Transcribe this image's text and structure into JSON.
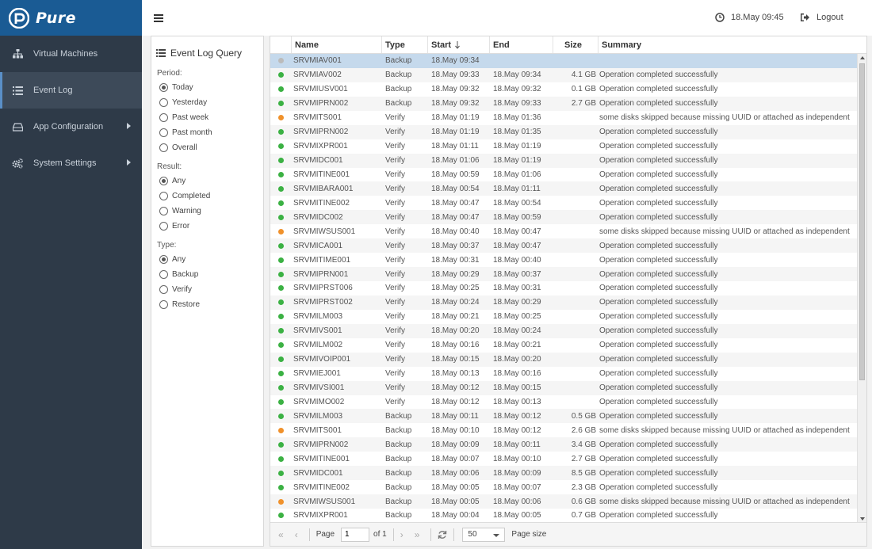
{
  "brand": {
    "name": "Pure",
    "color": "#1a5b94"
  },
  "sidebar": {
    "items": [
      {
        "label": "Virtual Machines",
        "icon": "sitemap-icon",
        "active": false,
        "has_arrow": false
      },
      {
        "label": "Event Log",
        "icon": "list-icon",
        "active": true,
        "has_arrow": false
      },
      {
        "label": "App Configuration",
        "icon": "drive-icon",
        "active": false,
        "has_arrow": true
      },
      {
        "label": "System Settings",
        "icon": "gears-icon",
        "active": false,
        "has_arrow": true
      }
    ]
  },
  "topbar": {
    "datetime": "18.May 09:45",
    "logout_label": "Logout"
  },
  "query": {
    "title": "Event Log Query",
    "period": {
      "label": "Period:",
      "options": [
        "Today",
        "Yesterday",
        "Past week",
        "Past month",
        "Overall"
      ],
      "selected": "Today"
    },
    "result": {
      "label": "Result:",
      "options": [
        "Any",
        "Completed",
        "Warning",
        "Error"
      ],
      "selected": "Any"
    },
    "type": {
      "label": "Type:",
      "options": [
        "Any",
        "Backup",
        "Verify",
        "Restore"
      ],
      "selected": "Any"
    }
  },
  "grid": {
    "columns": [
      "Name",
      "Type",
      "Start",
      "End",
      "Size",
      "Summary"
    ],
    "sort_column": "Start",
    "status_colors": {
      "success": "#3bb143",
      "warning": "#f0912b",
      "running": "#bbbbbb"
    },
    "rows": [
      {
        "status": "running",
        "name": "SRVMIAV001",
        "type": "Backup",
        "start": "18.May 09:34",
        "end": "",
        "size": "",
        "summary": "",
        "selected": true
      },
      {
        "status": "success",
        "name": "SRVMIAV002",
        "type": "Backup",
        "start": "18.May 09:33",
        "end": "18.May 09:34",
        "size": "4.1 GB",
        "summary": "Operation completed successfully"
      },
      {
        "status": "success",
        "name": "SRVMIUSV001",
        "type": "Backup",
        "start": "18.May 09:32",
        "end": "18.May 09:32",
        "size": "0.1 GB",
        "summary": "Operation completed successfully"
      },
      {
        "status": "success",
        "name": "SRVMIPRN002",
        "type": "Backup",
        "start": "18.May 09:32",
        "end": "18.May 09:33",
        "size": "2.7 GB",
        "summary": "Operation completed successfully"
      },
      {
        "status": "warning",
        "name": "SRVMITS001",
        "type": "Verify",
        "start": "18.May 01:19",
        "end": "18.May 01:36",
        "size": "",
        "summary": "some disks skipped because missing UUID or attached as independent"
      },
      {
        "status": "success",
        "name": "SRVMIPRN002",
        "type": "Verify",
        "start": "18.May 01:19",
        "end": "18.May 01:35",
        "size": "",
        "summary": "Operation completed successfully"
      },
      {
        "status": "success",
        "name": "SRVMIXPR001",
        "type": "Verify",
        "start": "18.May 01:11",
        "end": "18.May 01:19",
        "size": "",
        "summary": "Operation completed successfully"
      },
      {
        "status": "success",
        "name": "SRVMIDC001",
        "type": "Verify",
        "start": "18.May 01:06",
        "end": "18.May 01:19",
        "size": "",
        "summary": "Operation completed successfully"
      },
      {
        "status": "success",
        "name": "SRVMITINE001",
        "type": "Verify",
        "start": "18.May 00:59",
        "end": "18.May 01:06",
        "size": "",
        "summary": "Operation completed successfully"
      },
      {
        "status": "success",
        "name": "SRVMIBARA001",
        "type": "Verify",
        "start": "18.May 00:54",
        "end": "18.May 01:11",
        "size": "",
        "summary": "Operation completed successfully"
      },
      {
        "status": "success",
        "name": "SRVMITINE002",
        "type": "Verify",
        "start": "18.May 00:47",
        "end": "18.May 00:54",
        "size": "",
        "summary": "Operation completed successfully"
      },
      {
        "status": "success",
        "name": "SRVMIDC002",
        "type": "Verify",
        "start": "18.May 00:47",
        "end": "18.May 00:59",
        "size": "",
        "summary": "Operation completed successfully"
      },
      {
        "status": "warning",
        "name": "SRVMIWSUS001",
        "type": "Verify",
        "start": "18.May 00:40",
        "end": "18.May 00:47",
        "size": "",
        "summary": "some disks skipped because missing UUID or attached as independent"
      },
      {
        "status": "success",
        "name": "SRVMICA001",
        "type": "Verify",
        "start": "18.May 00:37",
        "end": "18.May 00:47",
        "size": "",
        "summary": "Operation completed successfully"
      },
      {
        "status": "success",
        "name": "SRVMITIME001",
        "type": "Verify",
        "start": "18.May 00:31",
        "end": "18.May 00:40",
        "size": "",
        "summary": "Operation completed successfully"
      },
      {
        "status": "success",
        "name": "SRVMIPRN001",
        "type": "Verify",
        "start": "18.May 00:29",
        "end": "18.May 00:37",
        "size": "",
        "summary": "Operation completed successfully"
      },
      {
        "status": "success",
        "name": "SRVMIPRST006",
        "type": "Verify",
        "start": "18.May 00:25",
        "end": "18.May 00:31",
        "size": "",
        "summary": "Operation completed successfully"
      },
      {
        "status": "success",
        "name": "SRVMIPRST002",
        "type": "Verify",
        "start": "18.May 00:24",
        "end": "18.May 00:29",
        "size": "",
        "summary": "Operation completed successfully"
      },
      {
        "status": "success",
        "name": "SRVMILM003",
        "type": "Verify",
        "start": "18.May 00:21",
        "end": "18.May 00:25",
        "size": "",
        "summary": "Operation completed successfully"
      },
      {
        "status": "success",
        "name": "SRVMIVS001",
        "type": "Verify",
        "start": "18.May 00:20",
        "end": "18.May 00:24",
        "size": "",
        "summary": "Operation completed successfully"
      },
      {
        "status": "success",
        "name": "SRVMILM002",
        "type": "Verify",
        "start": "18.May 00:16",
        "end": "18.May 00:21",
        "size": "",
        "summary": "Operation completed successfully"
      },
      {
        "status": "success",
        "name": "SRVMIVOIP001",
        "type": "Verify",
        "start": "18.May 00:15",
        "end": "18.May 00:20",
        "size": "",
        "summary": "Operation completed successfully"
      },
      {
        "status": "success",
        "name": "SRVMIEJ001",
        "type": "Verify",
        "start": "18.May 00:13",
        "end": "18.May 00:16",
        "size": "",
        "summary": "Operation completed successfully"
      },
      {
        "status": "success",
        "name": "SRVMIVSI001",
        "type": "Verify",
        "start": "18.May 00:12",
        "end": "18.May 00:15",
        "size": "",
        "summary": "Operation completed successfully"
      },
      {
        "status": "success",
        "name": "SRVMIMO002",
        "type": "Verify",
        "start": "18.May 00:12",
        "end": "18.May 00:13",
        "size": "",
        "summary": "Operation completed successfully"
      },
      {
        "status": "success",
        "name": "SRVMILM003",
        "type": "Backup",
        "start": "18.May 00:11",
        "end": "18.May 00:12",
        "size": "0.5 GB",
        "summary": "Operation completed successfully"
      },
      {
        "status": "warning",
        "name": "SRVMITS001",
        "type": "Backup",
        "start": "18.May 00:10",
        "end": "18.May 00:12",
        "size": "2.6 GB",
        "summary": "some disks skipped because missing UUID or attached as independent"
      },
      {
        "status": "success",
        "name": "SRVMIPRN002",
        "type": "Backup",
        "start": "18.May 00:09",
        "end": "18.May 00:11",
        "size": "3.4 GB",
        "summary": "Operation completed successfully"
      },
      {
        "status": "success",
        "name": "SRVMITINE001",
        "type": "Backup",
        "start": "18.May 00:07",
        "end": "18.May 00:10",
        "size": "2.7 GB",
        "summary": "Operation completed successfully"
      },
      {
        "status": "success",
        "name": "SRVMIDC001",
        "type": "Backup",
        "start": "18.May 00:06",
        "end": "18.May 00:09",
        "size": "8.5 GB",
        "summary": "Operation completed successfully"
      },
      {
        "status": "success",
        "name": "SRVMITINE002",
        "type": "Backup",
        "start": "18.May 00:05",
        "end": "18.May 00:07",
        "size": "2.3 GB",
        "summary": "Operation completed successfully"
      },
      {
        "status": "warning",
        "name": "SRVMIWSUS001",
        "type": "Backup",
        "start": "18.May 00:05",
        "end": "18.May 00:06",
        "size": "0.6 GB",
        "summary": "some disks skipped because missing UUID or attached as independent"
      },
      {
        "status": "success",
        "name": "SRVMIXPR001",
        "type": "Backup",
        "start": "18.May 00:04",
        "end": "18.May 00:05",
        "size": "0.7 GB",
        "summary": "Operation completed successfully"
      }
    ]
  },
  "pager": {
    "page_label": "Page",
    "page_value": "1",
    "of_label": "of 1",
    "page_size_value": "50",
    "page_size_label": "Page size"
  }
}
